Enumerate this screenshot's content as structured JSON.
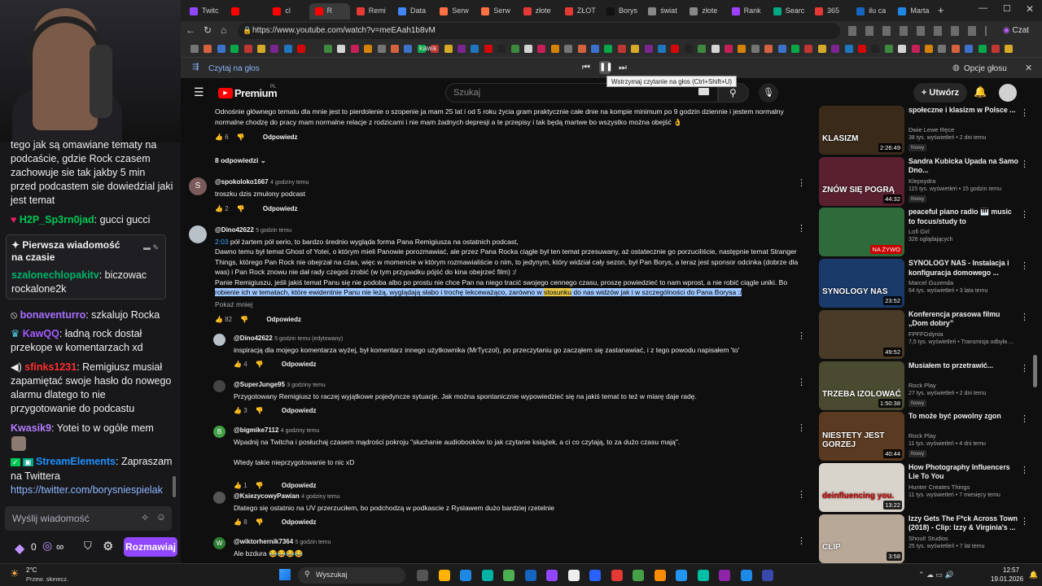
{
  "twitch": {
    "chat": [
      {
        "user": "",
        "text": "tego jak są omawiane tematy na podcaście, gdzie Rock czasem zachowuje sie tak jakby 5 min przed podcastem sie dowiedzial jaki jest temat",
        "color": "#efeff1"
      },
      {
        "user": "H2P_Sp3rn0jad",
        "text": "gucci gucci",
        "color": "#00c853"
      },
      {
        "user": "bonaventurro",
        "text": "szkalujo Rocka",
        "color": "#9147ff"
      },
      {
        "user": "KawQQ",
        "text": "ładną rock dostał przekope w komentarzach xd",
        "color": "#8a2be2"
      },
      {
        "user": "sfinks1231",
        "text": "Remigiusz musiał zapamiętać swoje hasło do nowego alarmu dlatego to nie przygotowanie do podcastu",
        "color": "#ff2d2d"
      },
      {
        "user": "Kwasik9",
        "text": "Yotei to w ogóle mem",
        "color": "#b57bff"
      },
      {
        "user": "StreamElements",
        "text": "Zapraszam na Twittera",
        "color": "#1e90ff"
      }
    ],
    "link": "https://twitter.com/borysniespielak",
    "pinned": {
      "title": "Pierwsza wiadomość na czasie",
      "user": "szalonechlopakitv",
      "text": "biczowac rockalone2k"
    },
    "input_placeholder": "Wyślij wiadomość",
    "points": "0",
    "infinity": "∞",
    "chat_button": "Rozmawiaj"
  },
  "browser": {
    "tabs": [
      "Twitc",
      "",
      "cl",
      "R",
      "Remi",
      "Data",
      "Serw",
      "Serw",
      "złote",
      "ZŁOT",
      "Borys",
      "świat",
      "złote",
      "Rank",
      "Searc",
      "365",
      "ilu ca",
      "Marta"
    ],
    "url": "https://www.youtube.com/watch?v=meEAah1b8vM",
    "bookmark_kawa": "kawa",
    "profile": "Czat",
    "read_aloud": "Czytaj na głos",
    "voice_options": "Opcje głosu",
    "tooltip": "Wstrzymaj czytanie na głos (Ctrl+Shift+U)"
  },
  "youtube": {
    "logo": "Premium",
    "logo_pl": "PL",
    "search_placeholder": "Szukaj",
    "create": "Utwórz",
    "reply_label": "Odpowiedz",
    "comments": [
      {
        "id": "c0",
        "text": "Odnośnie głównego tematu dla mnie jest to pierdolenie o szopenie ja mam 25 lat i od 5 roku życia gram praktycznie całe dnie na kompie minimum po 9 godzin dziennie i jestem normalny normalne chodzę do pracy mam normalne relacje z rodzicami i nie mam żadnych depresji a te przepisy i tak będą martwe bo wszystko można obejść 👌",
        "likes": "6",
        "replies": "8 odpowiedzi"
      },
      {
        "id": "c1",
        "author": "@spokoloko1667",
        "time": "4 godziny temu",
        "text": "troszku dzis zmulony podcast",
        "likes": "2"
      },
      {
        "id": "c2",
        "author": "@Dino42622",
        "time": "5 godzin temu",
        "timestamp": "2:03",
        "text1": " pół żartem pół serio, to bardzo średnio wygląda forma Pana Remigiusza na ostatnich podcast,",
        "text2": " Dawno temu był temat Ghost of Yotei, o którym mieli Panowie porozmawiać, ale przez Pana Rocka ciągle był ten temat przesuwany, aż ostatecznie go porzuciliście, następnie temat Stranger Things, którego Pan Rock nie obejrzał na czas, więc w momencie w którym rozmawialiście o nim, to jedynym, który widział cały sezon, był Pan Borys, a teraz jest sponsor odcinka (dobrze dla was) i Pan Rock znowu nie dał rady czegoś zrobić (w tym przypadku pójść do kina obejrzeć film) :/",
        "text3": " Panie Remigiuszu, jeśli jakiś temat Panu się nie podoba albo po prostu nie chce Pan na niego tracić swojego cennego czasu, proszę powiedzieć to nam wprost, a nie robić ciągle uniki. Bo",
        "hl_a": "robienie ich w tematach, które ewidentnie Panu nie leżą, wyglądają słabo i trochę lekceważąco, zarówno w ",
        "hl_word": "stosunku",
        "hl_b": " do nas widzów jak i w szczególności do Pana Borysa :/",
        "less": "Pokaż mniej",
        "likes": "82"
      },
      {
        "id": "r1",
        "author": "@Dino42622",
        "time": "5 godzin temu (edytowany)",
        "text": "inspiracją dla mojego komentarza wyżej, był komentarz innego użytkownika (MrTyczol), po przeczytaniu go zacząłem się zastanawiać, i z tego powodu napisałem 'to'",
        "likes": "4"
      },
      {
        "id": "r2",
        "author": "@SuperJunge95",
        "time": "3 godziny temu",
        "text": "Przygotowany Remigiusz to raczej wyjątkowe pojedyncze sytuacje. Jak można spontanicznie wypowiedzieć się na jakiś temat to też w miarę daje radę.",
        "likes": "3"
      },
      {
        "id": "r3",
        "author": "@bigmike7112",
        "time": "4 godziny temu",
        "text": "Wpadnij na Twitcha i posłuchaj czasem mądrości pokroju \"słuchanie audiobooków to jak czytanie książek, a ci co czytają, to za dużo czasu mają\".",
        "text2": "Wtedy takie nieprzygotowanie to nic xD",
        "likes": "1"
      },
      {
        "id": "r4",
        "author": "@KsiezycowyPawian",
        "time": "4 godziny temu",
        "text": "Dlatego się ostatnio na UV przerzuciłem, bo podchodzą w podkascie z Ryslawem dużo bardziej rzetelnie",
        "likes": "8"
      },
      {
        "id": "r5",
        "author": "@wiktorhernik7364",
        "time": "5 godzin temu",
        "text": "Ale bzdura 😂😂😂😂"
      }
    ],
    "recommended": [
      {
        "title": "społeczne i klasizm w Polsce ...",
        "channel": "Dwie Lewe Ręce",
        "meta": "38 tys. wyświetleń • 2 dni temu",
        "duration": "2:26:49",
        "new": "Nowy",
        "thumb": "KLASIZM",
        "color": "#3a2a1a"
      },
      {
        "title": "Sandra Kubicka Upada na Samo Dno...",
        "channel": "Klepsydra",
        "meta": "115 tys. wyświetleń • 15 godzin temu",
        "duration": "44:32",
        "new": "Nowy",
        "thumb": "ZNÓW SIĘ POGRĄ",
        "color": "#5a2030"
      },
      {
        "title": "peaceful piano radio 🎹 music to focus/study to",
        "channel": "Lofi Girl",
        "meta": "326 oglądających",
        "duration": "NA ŻYWO",
        "new": "",
        "thumb": "",
        "color": "#2f6a3a"
      },
      {
        "title": "SYNOLOGY NAS - Instalacja i konfiguracja domowego ...",
        "channel": "Marcel Guzenda",
        "meta": "64 tys. wyświetleń • 3 lata temu",
        "duration": "23:52",
        "new": "",
        "thumb": "SYNOLOGY NAS",
        "color": "#1a3a6a"
      },
      {
        "title": "Konferencja prasowa filmu „Dom dobry”",
        "channel": "FPFFGdynia",
        "meta": "7,5 tys. wyświetleń • Transmisja odbyła ...",
        "duration": "49:52",
        "new": "",
        "thumb": "",
        "color": "#4a3a28"
      },
      {
        "title": "Musiałem to przetrawić...",
        "channel": "Rock Play",
        "meta": "27 tys. wyświetleń • 2 dni temu",
        "duration": "1:50:38",
        "new": "Nowy",
        "thumb": "TRZEBA IZOLOWAĆ",
        "color": "#4a4a30"
      },
      {
        "title": "To może być powolny zgon",
        "channel": "Rock Play",
        "meta": "11 tys. wyświetleń • 4 dni temu",
        "duration": "40:44",
        "new": "Nowy",
        "thumb": "NIESTETY JEST GORZEJ",
        "color": "#5a3a20"
      },
      {
        "title": "How Photography Influencers Lie To You",
        "channel": "Hunter Creates Things",
        "meta": "11 tys. wyświetleń • 7 miesięcy temu",
        "duration": "13:22",
        "new": "",
        "thumb": "deinfluencing you.",
        "color": "#d8d4cc"
      },
      {
        "title": "Izzy Gets The F*ck Across Town (2018) - Clip: Izzy & Virginia's ...",
        "channel": "Shout! Studios",
        "meta": "25 tys. wyświetleń • 7 lat temu",
        "duration": "3:58",
        "new": "",
        "thumb": "CLIP",
        "color": "#b8a898"
      }
    ]
  },
  "taskbar": {
    "temp": "2°C",
    "weather": "Przew. słonecz.",
    "search": "Wyszukaj",
    "time": "12:57",
    "date": "19.01.2026"
  }
}
